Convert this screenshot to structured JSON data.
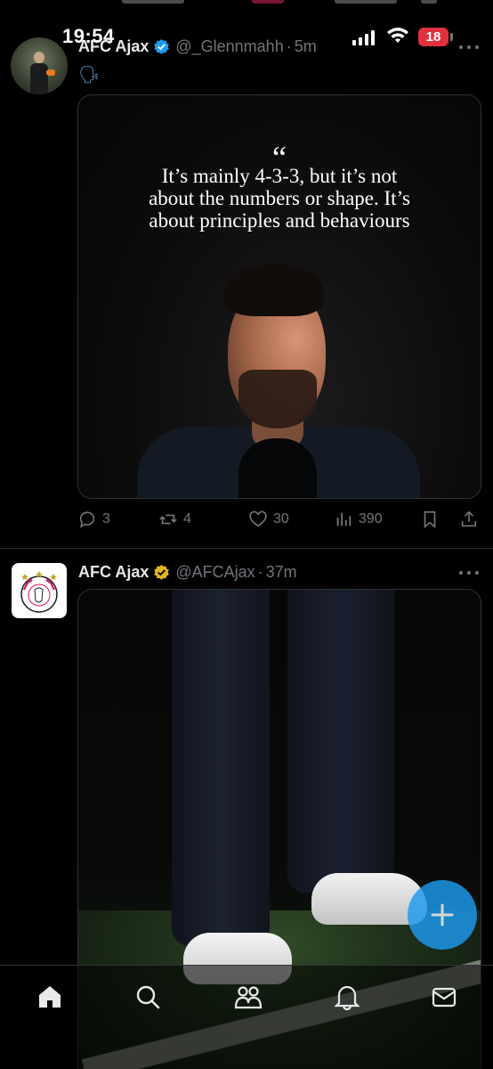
{
  "status_bar": {
    "time": "19:54",
    "battery_level": "18",
    "battery_color": "#e0313d"
  },
  "tweets": [
    {
      "display_name": "AFC Ajax",
      "verified_badge": "blue-check-icon",
      "handle": "@_Glennmahh",
      "separator": "·",
      "time_ago": "5m",
      "emoji": "🗣",
      "media_quote_mark": "“",
      "media_quote": "It’s mainly 4-3-3, but it’s not about the numbers or shape. It’s about principles and behaviours",
      "replies": "3",
      "reposts": "4",
      "likes": "30",
      "views": "390"
    },
    {
      "display_name": "AFC Ajax",
      "verified_badge": "gold-check-icon",
      "handle": "@AFCAjax",
      "separator": "·",
      "time_ago": "37m"
    }
  ],
  "colors": {
    "accent": "#1d9bf0",
    "gold_badge": "#e2b719",
    "muted_text": "#71767b",
    "background": "#000000"
  },
  "bottom_nav": {
    "items": [
      "home-icon",
      "search-icon",
      "communities-icon",
      "notifications-icon",
      "messages-icon"
    ],
    "active": "home-icon"
  },
  "fab": {
    "icon": "compose-plus-icon"
  }
}
